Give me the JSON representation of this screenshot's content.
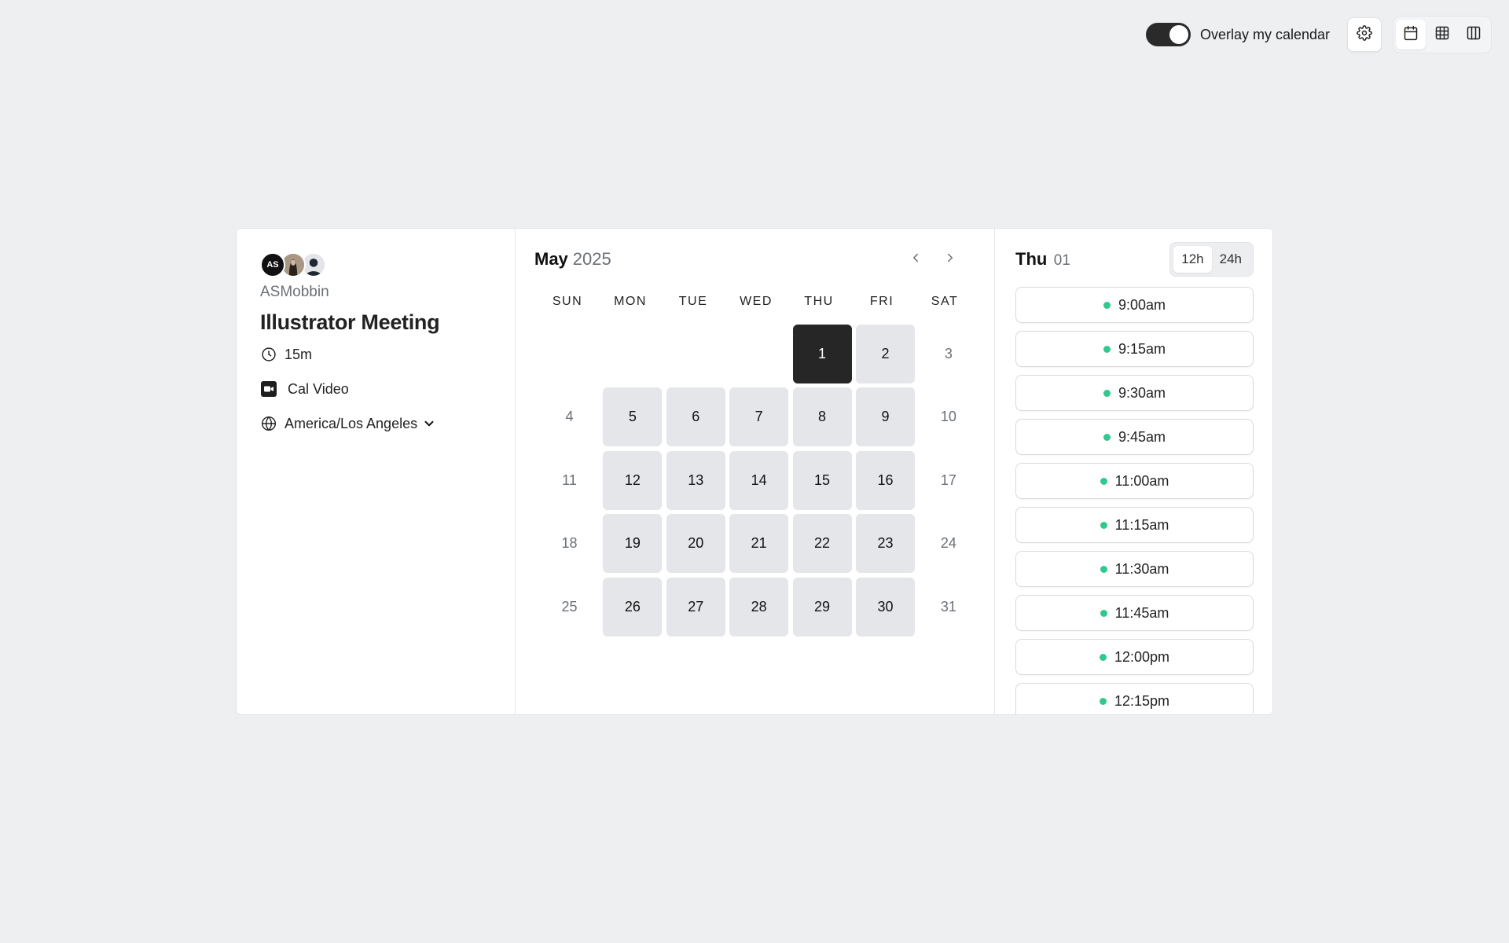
{
  "toolbar": {
    "overlay_label": "Overlay my calendar",
    "overlay_on": true,
    "settings_icon": "gear-icon",
    "views": [
      {
        "icon": "calendar-icon",
        "active": true
      },
      {
        "icon": "grid-icon",
        "active": false
      },
      {
        "icon": "columns-icon",
        "active": false
      }
    ]
  },
  "event": {
    "avatar_initials": "AS",
    "host": "ASMobbin",
    "title": "Illustrator Meeting",
    "duration": "15m",
    "location": "Cal Video",
    "timezone": "America/Los Angeles"
  },
  "calendar": {
    "month": "May",
    "year": "2025",
    "weekdays": [
      "SUN",
      "MON",
      "TUE",
      "WED",
      "THU",
      "FRI",
      "SAT"
    ],
    "days": [
      {
        "label": "",
        "state": "empty"
      },
      {
        "label": "",
        "state": "empty"
      },
      {
        "label": "",
        "state": "empty"
      },
      {
        "label": "",
        "state": "empty"
      },
      {
        "label": "1",
        "state": "selected"
      },
      {
        "label": "2",
        "state": "avail"
      },
      {
        "label": "3",
        "state": "off"
      },
      {
        "label": "4",
        "state": "off"
      },
      {
        "label": "5",
        "state": "avail"
      },
      {
        "label": "6",
        "state": "avail"
      },
      {
        "label": "7",
        "state": "avail"
      },
      {
        "label": "8",
        "state": "avail"
      },
      {
        "label": "9",
        "state": "avail"
      },
      {
        "label": "10",
        "state": "off"
      },
      {
        "label": "11",
        "state": "off"
      },
      {
        "label": "12",
        "state": "avail"
      },
      {
        "label": "13",
        "state": "avail"
      },
      {
        "label": "14",
        "state": "avail"
      },
      {
        "label": "15",
        "state": "avail"
      },
      {
        "label": "16",
        "state": "avail"
      },
      {
        "label": "17",
        "state": "off"
      },
      {
        "label": "18",
        "state": "off"
      },
      {
        "label": "19",
        "state": "avail"
      },
      {
        "label": "20",
        "state": "avail"
      },
      {
        "label": "21",
        "state": "avail"
      },
      {
        "label": "22",
        "state": "avail"
      },
      {
        "label": "23",
        "state": "avail"
      },
      {
        "label": "24",
        "state": "off"
      },
      {
        "label": "25",
        "state": "off"
      },
      {
        "label": "26",
        "state": "avail"
      },
      {
        "label": "27",
        "state": "avail"
      },
      {
        "label": "28",
        "state": "avail"
      },
      {
        "label": "29",
        "state": "avail"
      },
      {
        "label": "30",
        "state": "avail"
      },
      {
        "label": "31",
        "state": "off"
      }
    ]
  },
  "slots": {
    "day_of_week": "Thu",
    "day_number": "01",
    "format_options": [
      "12h",
      "24h"
    ],
    "format_selected": "12h",
    "times": [
      "9:00am",
      "9:15am",
      "9:30am",
      "9:45am",
      "11:00am",
      "11:15am",
      "11:30am",
      "11:45am",
      "12:00pm",
      "12:15pm"
    ],
    "available_color": "#2fc98e"
  }
}
